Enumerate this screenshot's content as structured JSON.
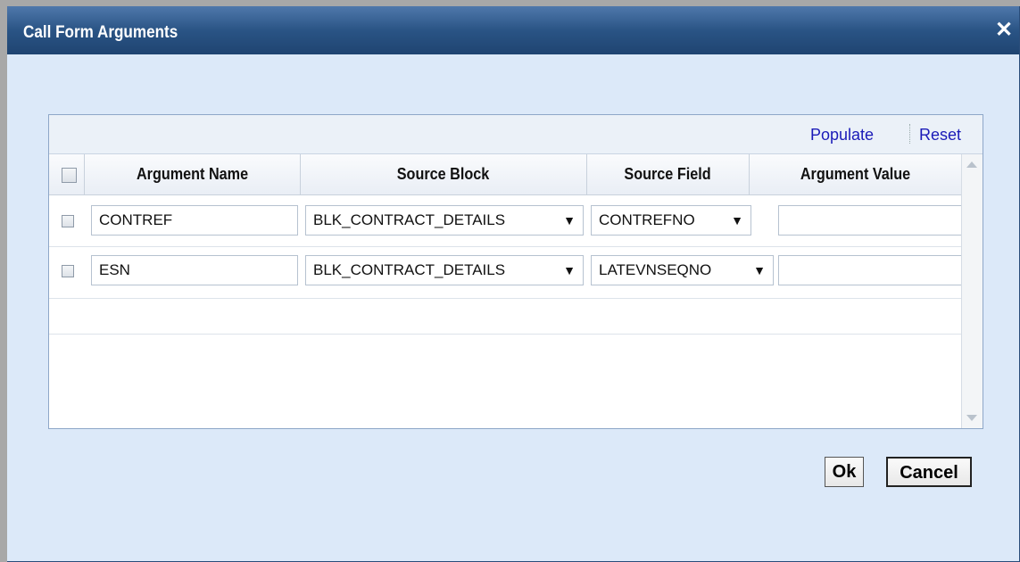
{
  "dialog": {
    "title": "Call Form Arguments",
    "close_symbol": "✕"
  },
  "toolbar": {
    "populate_label": "Populate",
    "reset_label": "Reset"
  },
  "grid": {
    "columns": [
      "Argument Name",
      "Source Block",
      "Source Field",
      "Argument Value"
    ],
    "rows": [
      {
        "argument_name": "CONTREF",
        "source_block": "BLK_CONTRACT_DETAILS",
        "source_field": "CONTREFNO",
        "argument_value": ""
      },
      {
        "argument_name": "ESN",
        "source_block": "BLK_CONTRACT_DETAILS",
        "source_field": "LATEVNSEQNO",
        "argument_value": ""
      }
    ]
  },
  "buttons": {
    "ok_label": "Ok",
    "cancel_label": "Cancel"
  },
  "icons": {
    "dropdown": "▼"
  },
  "colors": {
    "titlebar": "#2a5485",
    "dialog_bg": "#dce9f9",
    "link": "#1b1bb8"
  }
}
